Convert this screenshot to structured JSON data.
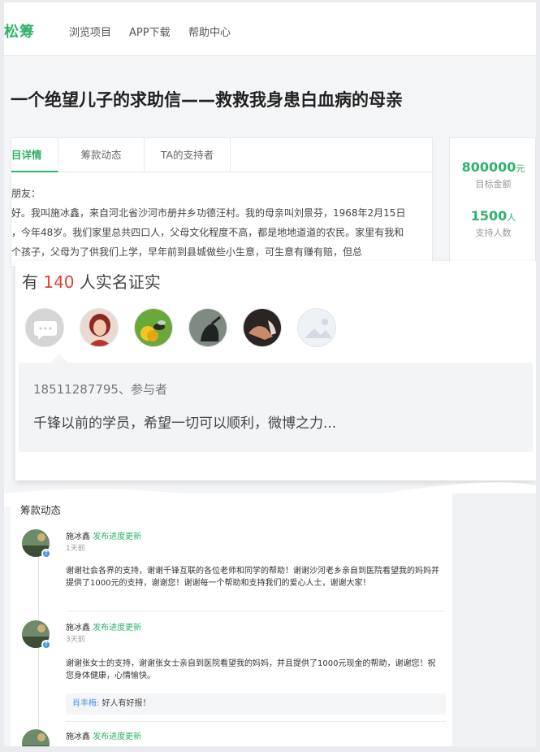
{
  "nav": {
    "logo": "松筹",
    "links": [
      "浏览项目",
      "APP下载",
      "帮助中心"
    ]
  },
  "project": {
    "title": "一个绝望儿子的求助信——救救我身患白血病的母亲",
    "tabs": [
      "目详情",
      "筹款动态",
      "TA的支持者"
    ],
    "body_lines": [
      "朋友：",
      "好。我叫施冰鑫，来自河北省沙河市册井乡功德汪村。我的母亲叫刘景芬，1968年2月15日",
      "，今年48岁。我们家里总共四口人，父母文化程度不高，都是地地道道的农民。家里有我和",
      "个孩子，父母为了供我们上学，早年前到县城做些小生意，可生意有赚有赔，但总"
    ]
  },
  "stats": {
    "target_value": "800000",
    "target_unit": "元",
    "target_label": "目标金额",
    "supporters_value": "1500",
    "supporters_unit": "人",
    "supporters_label": "支持人数"
  },
  "verify": {
    "prefix": "有",
    "count": "140",
    "suffix": "人实名证实",
    "callout_user": "18511287795、参与者",
    "callout_message": "千锋以前的学员，希望一切可以顺利，微博之力..."
  },
  "updates": {
    "title": "筹款动态",
    "items": [
      {
        "name": "施冰鑫",
        "action": "发布进度更新",
        "time": "1天前",
        "text": "谢谢社会各界的支持，谢谢千锋互联的各位老师和同学的帮助！谢谢沙河老乡亲自到医院看望我的妈妈并提供了1000元的支持，谢谢您！谢谢每一个帮助和支持我们的爱心人士，谢谢大家！"
      },
      {
        "name": "施冰鑫",
        "action": "发布进度更新",
        "time": "3天前",
        "text": "谢谢张女士的支持，谢谢张女士亲自到医院看望我的妈妈，并且提供了1000元现金的帮助，谢谢您！祝您身体健康，心情愉快。",
        "comment_name": "肖丰梅:",
        "comment_text": "好人有好报！"
      },
      {
        "name": "施冰鑫",
        "action": "发布进度更新"
      }
    ]
  }
}
